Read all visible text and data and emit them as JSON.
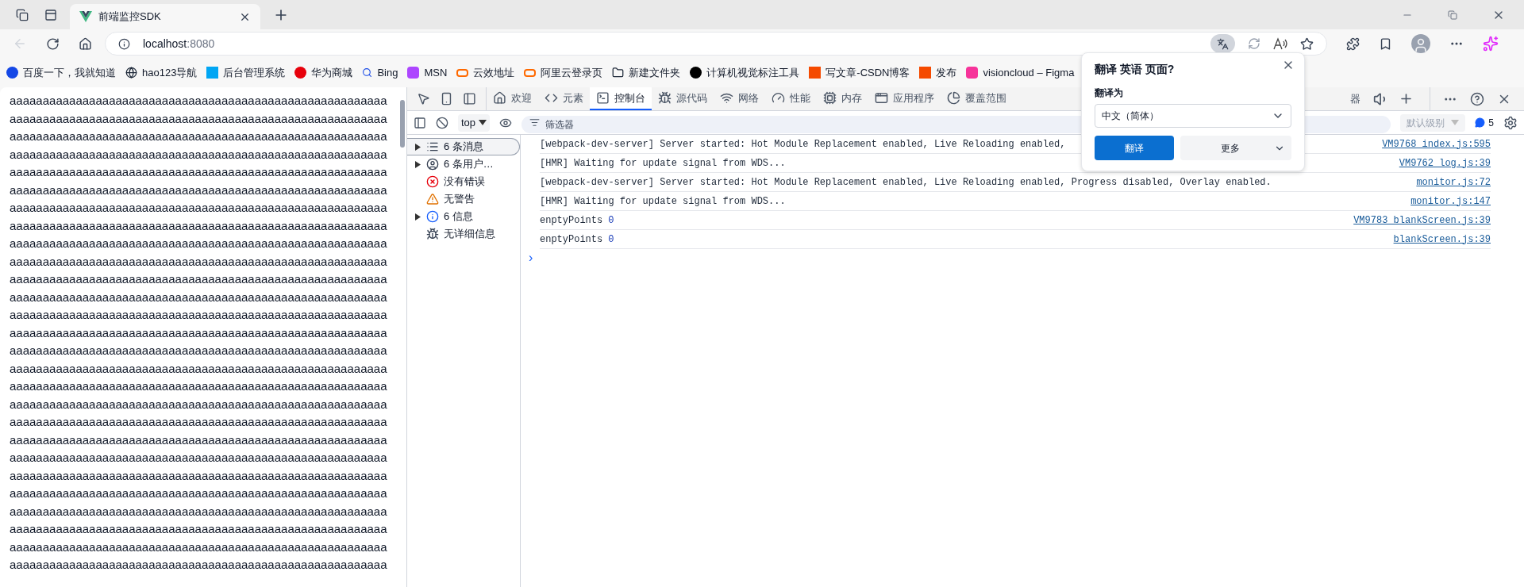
{
  "browser": {
    "tab": {
      "title": "前端监控SDK",
      "selected": true
    },
    "address": {
      "host": "localhost",
      "port": ":8080"
    },
    "bookmarks": [
      "百度一下，我就知道",
      "hao123导航",
      "后台管理系统",
      "华为商城",
      "Bing",
      "MSN",
      "云效地址",
      "阿里云登录页",
      "新建文件夹",
      "计算机视觉标注工具",
      "写文章-CSDN博客",
      "发布",
      "visioncloud – Figma"
    ]
  },
  "page": {
    "lines": [
      "aaaaaaaaaaaaaaaaaaaaaaaaaaaaaaaaaaaaaaaaaaaaaaaaaaaaaaaaa",
      "aaaaaaaaaaaaaaaaaaaaaaaaaaaaaaaaaaaaaaaaaaaaaaaaaaaaaaaaa",
      "aaaaaaaaaaaaaaaaaaaaaaaaaaaaaaaaaaaaaaaaaaaaaaaaaaaaaaaaa",
      "aaaaaaaaaaaaaaaaaaaaaaaaaaaaaaaaaaaaaaaaaaaaaaaaaaaaaaaaa",
      "aaaaaaaaaaaaaaaaaaaaaaaaaaaaaaaaaaaaaaaaaaaaaaaaaaaaaaaaa",
      "aaaaaaaaaaaaaaaaaaaaaaaaaaaaaaaaaaaaaaaaaaaaaaaaaaaaaaaaa",
      "aaaaaaaaaaaaaaaaaaaaaaaaaaaaaaaaaaaaaaaaaaaaaaaaaaaaaaaaa",
      "aaaaaaaaaaaaaaaaaaaaaaaaaaaaaaaaaaaaaaaaaaaaaaaaaaaaaaaaa",
      "aaaaaaaaaaaaaaaaaaaaaaaaaaaaaaaaaaaaaaaaaaaaaaaaaaaaaaaaa",
      "aaaaaaaaaaaaaaaaaaaaaaaaaaaaaaaaaaaaaaaaaaaaaaaaaaaaaaaaa",
      "aaaaaaaaaaaaaaaaaaaaaaaaaaaaaaaaaaaaaaaaaaaaaaaaaaaaaaaaa",
      "aaaaaaaaaaaaaaaaaaaaaaaaaaaaaaaaaaaaaaaaaaaaaaaaaaaaaaaaa",
      "aaaaaaaaaaaaaaaaaaaaaaaaaaaaaaaaaaaaaaaaaaaaaaaaaaaaaaaaa",
      "aaaaaaaaaaaaaaaaaaaaaaaaaaaaaaaaaaaaaaaaaaaaaaaaaaaaaaaaa",
      "aaaaaaaaaaaaaaaaaaaaaaaaaaaaaaaaaaaaaaaaaaaaaaaaaaaaaaaaa",
      "aaaaaaaaaaaaaaaaaaaaaaaaaaaaaaaaaaaaaaaaaaaaaaaaaaaaaaaaa",
      "aaaaaaaaaaaaaaaaaaaaaaaaaaaaaaaaaaaaaaaaaaaaaaaaaaaaaaaaa",
      "aaaaaaaaaaaaaaaaaaaaaaaaaaaaaaaaaaaaaaaaaaaaaaaaaaaaaaaaa",
      "aaaaaaaaaaaaaaaaaaaaaaaaaaaaaaaaaaaaaaaaaaaaaaaaaaaaaaaaa",
      "aaaaaaaaaaaaaaaaaaaaaaaaaaaaaaaaaaaaaaaaaaaaaaaaaaaaaaaaa",
      "aaaaaaaaaaaaaaaaaaaaaaaaaaaaaaaaaaaaaaaaaaaaaaaaaaaaaaaaa",
      "aaaaaaaaaaaaaaaaaaaaaaaaaaaaaaaaaaaaaaaaaaaaaaaaaaaaaaaaa",
      "aaaaaaaaaaaaaaaaaaaaaaaaaaaaaaaaaaaaaaaaaaaaaaaaaaaaaaaaa",
      "aaaaaaaaaaaaaaaaaaaaaaaaaaaaaaaaaaaaaaaaaaaaaaaaaaaaaaaaa",
      "aaaaaaaaaaaaaaaaaaaaaaaaaaaaaaaaaaaaaaaaaaaaaaaaaaaaaaaaa",
      "aaaaaaaaaaaaaaaaaaaaaaaaaaaaaaaaaaaaaaaaaaaaaaaaaaaaaaaaa",
      "aaaaaaaaaaaaaaaaaaaaaaaaaaaaaaaaaaaaaaaaaaaaaaaaaaaaaaaaa"
    ]
  },
  "devtools": {
    "tabs": [
      {
        "label": "欢迎",
        "selected": false
      },
      {
        "label": "元素",
        "selected": false
      },
      {
        "label": "控制台",
        "selected": true
      },
      {
        "label": "源代码",
        "selected": false
      },
      {
        "label": "网络",
        "selected": false
      },
      {
        "label": "性能",
        "selected": false
      },
      {
        "label": "内存",
        "selected": false
      },
      {
        "label": "应用程序",
        "selected": false
      },
      {
        "label": "覆盖范围",
        "selected": false
      }
    ],
    "extra_tab": "器",
    "context": "top",
    "filter": {
      "placeholder": "筛选器"
    },
    "level_select": "默认级别",
    "issues_count": "5",
    "sidebar": [
      {
        "label": "6 条消息",
        "selected": true,
        "expandable": true
      },
      {
        "label": "6 条用户…",
        "selected": false,
        "expandable": true
      },
      {
        "label": "没有错误",
        "selected": false,
        "expandable": false
      },
      {
        "label": "无警告",
        "selected": false,
        "expandable": false
      },
      {
        "label": "6 信息",
        "selected": false,
        "expandable": true
      },
      {
        "label": "无详细信息",
        "selected": false,
        "expandable": false
      }
    ],
    "messages": [
      {
        "text": "[webpack-dev-server] Server started: Hot Module Replacement enabled, Live Reloading enabled,",
        "source": "VM9768 index.js:595"
      },
      {
        "text": "[HMR] Waiting for update signal from WDS...",
        "source": "VM9762 log.js:39"
      },
      {
        "text": "[webpack-dev-server] Server started: Hot Module Replacement enabled, Live Reloading enabled, Progress disabled, Overlay enabled.",
        "source": "monitor.js:72"
      },
      {
        "text": "[HMR] Waiting for update signal from WDS...",
        "source": "monitor.js:147"
      },
      {
        "text": "enptyPoints",
        "value": "0",
        "source": "VM9783 blankScreen.js:39"
      },
      {
        "text": "enptyPoints",
        "value": "0",
        "source": "blankScreen.js:39"
      }
    ],
    "prompt": "›"
  },
  "translate_popup": {
    "title": "翻译 英语 页面?",
    "label": "翻译为",
    "language": "中文（简体）",
    "buttons": [
      "翻译",
      "更多"
    ]
  }
}
